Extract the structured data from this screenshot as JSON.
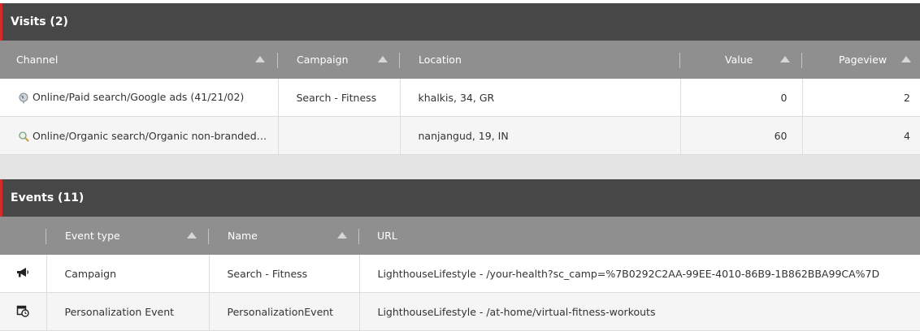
{
  "visits": {
    "title": "Visits (2)",
    "columns": {
      "channel": "Channel",
      "campaign": "Campaign",
      "location": "Location",
      "value": "Value",
      "pageview": "Pageview"
    },
    "rows": [
      {
        "channel": "Online/Paid search/Google ads (41/21/02)",
        "channel_icon": "globe-icon",
        "campaign": "Search - Fitness",
        "location": "khalkis, 34, GR",
        "value": "0",
        "pageview": "2"
      },
      {
        "channel": "Online/Organic search/Organic non-branded search",
        "channel_icon": "magnifier-icon",
        "campaign": "",
        "location": "nanjangud, 19, IN",
        "value": "60",
        "pageview": "4"
      }
    ]
  },
  "events": {
    "title": "Events (11)",
    "columns": {
      "event_type": "Event type",
      "name": "Name",
      "url": "URL"
    },
    "rows": [
      {
        "icon": "megaphone-icon",
        "event_type": "Campaign",
        "name": "Search - Fitness",
        "url": "LighthouseLifestyle - /your-health?sc_camp=%7B0292C2AA-99EE-4010-86B9-1B862BBA99CA%7D"
      },
      {
        "icon": "calendar-clock-icon",
        "event_type": "Personalization Event",
        "name": "PersonalizationEvent",
        "url": "LighthouseLifestyle - /at-home/virtual-fitness-workouts"
      }
    ]
  }
}
